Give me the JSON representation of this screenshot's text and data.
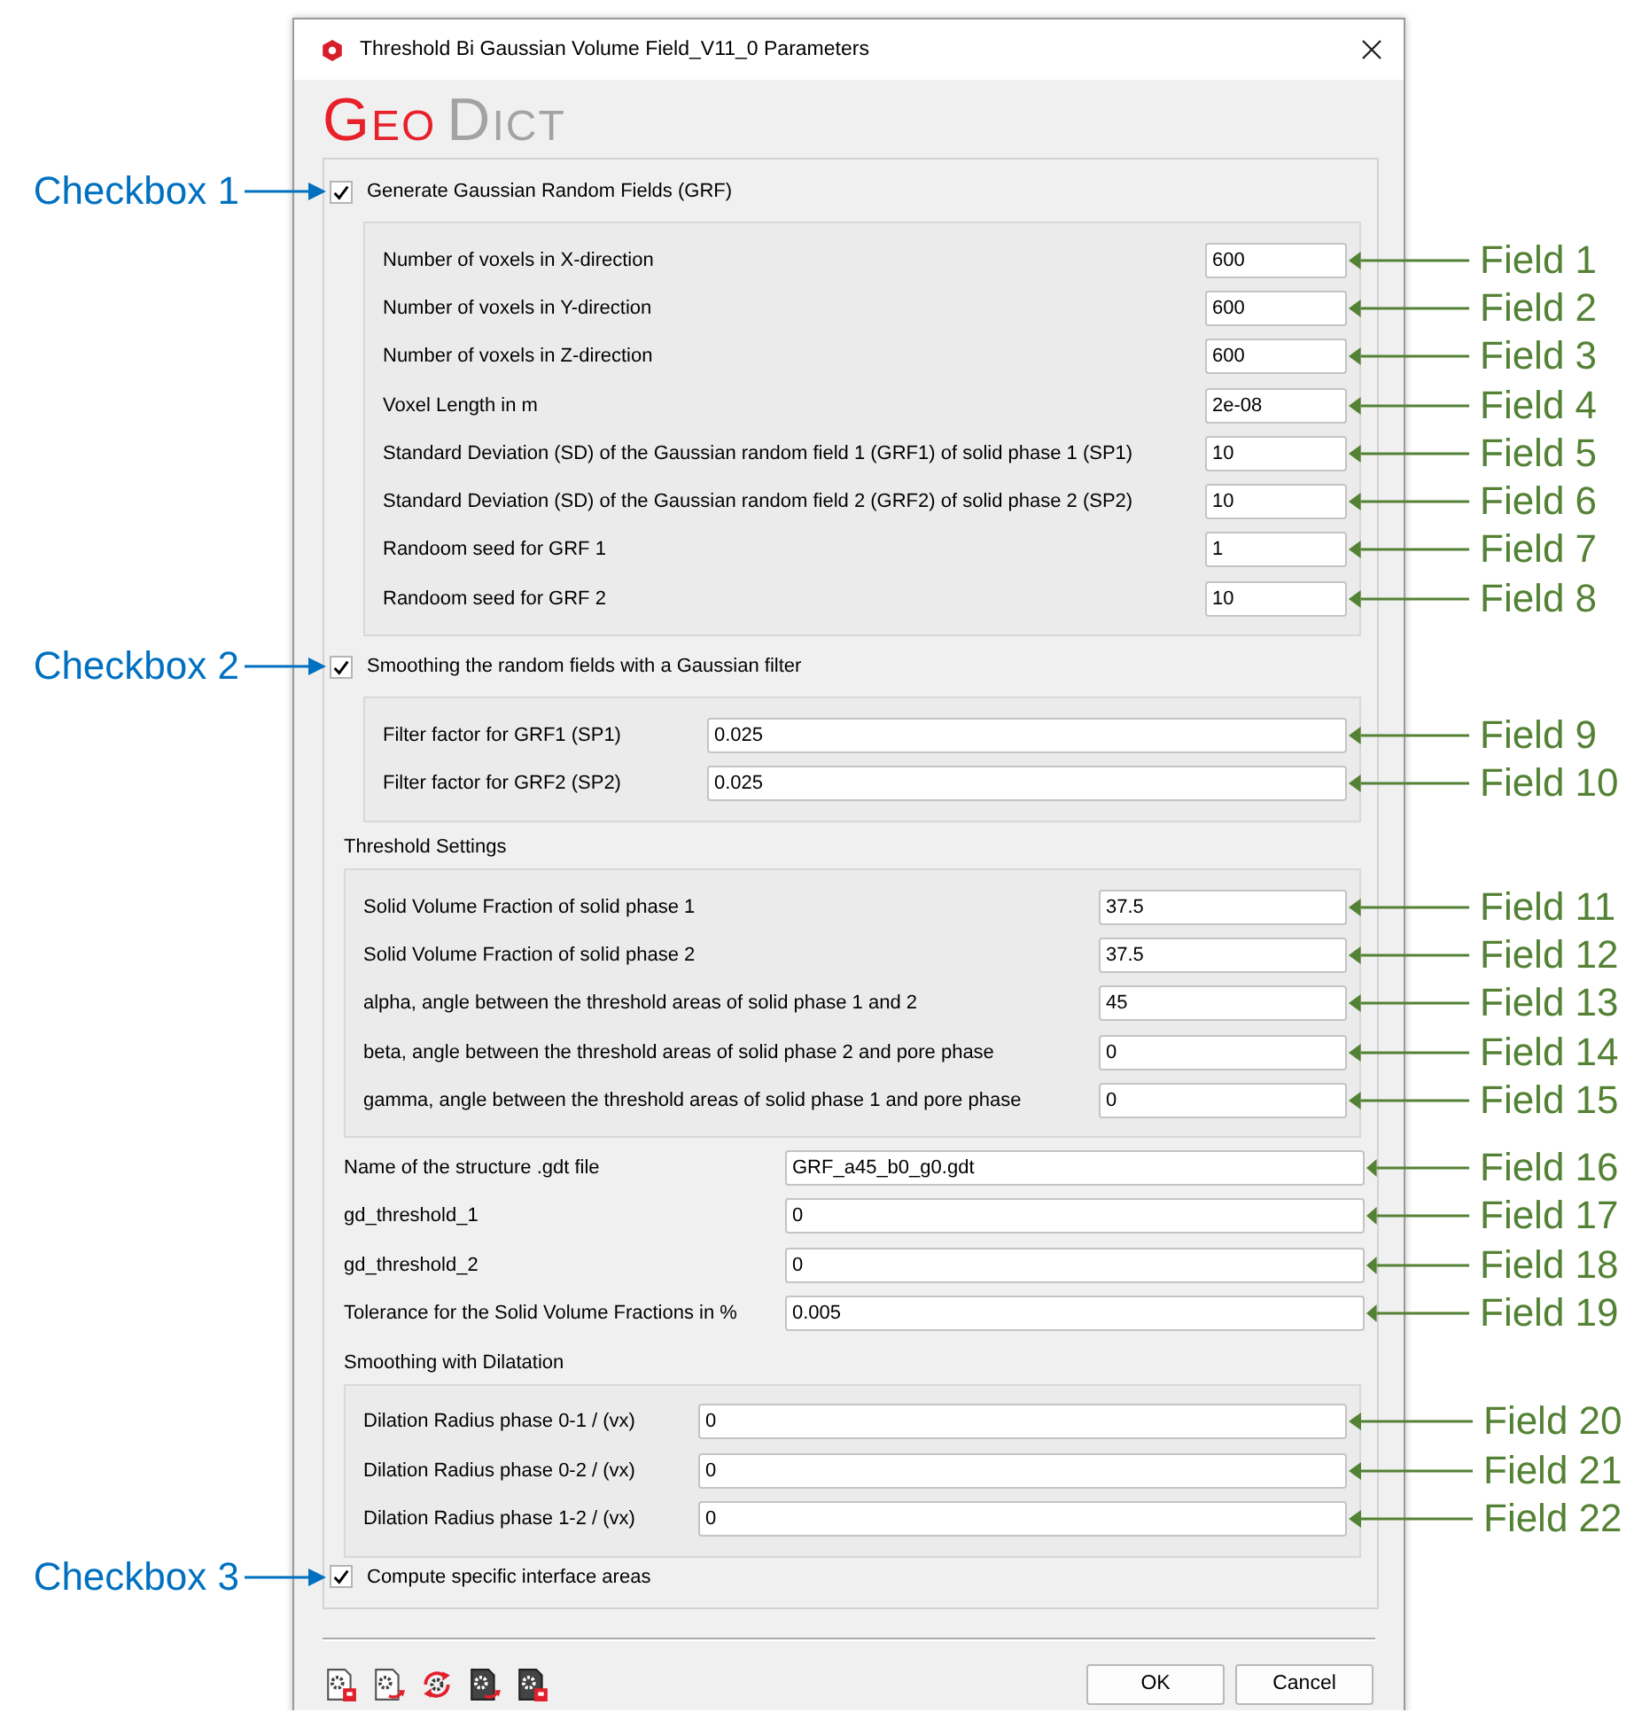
{
  "window": {
    "title": "Threshold Bi Gaussian Volume Field_V11_0 Parameters"
  },
  "logo": [
    {
      "text": "GEO",
      "color": "#e8202a"
    },
    {
      "text": "DICT",
      "color": "#a3a3a3"
    }
  ],
  "sections": [
    {
      "kind": "checkbox_group",
      "label": "Generate Gaussian Random Fields (GRF)",
      "checked": true,
      "callout": "Checkbox 1",
      "fields": [
        {
          "label": "Number of voxels in X-direction",
          "value": "600",
          "callout": "Field 1"
        },
        {
          "label": "Number of voxels in Y-direction",
          "value": "600",
          "callout": "Field 2"
        },
        {
          "label": "Number of voxels in Z-direction",
          "value": "600",
          "callout": "Field 3"
        },
        {
          "label": "Voxel Length in m",
          "value": "2e-08",
          "callout": "Field 4"
        },
        {
          "label": "Standard Deviation (SD) of the Gaussian random field 1 (GRF1) of solid phase 1 (SP1)",
          "value": "10",
          "callout": "Field 5"
        },
        {
          "label": "Standard Deviation (SD) of the Gaussian random field 2 (GRF2) of solid phase 2 (SP2)",
          "value": "10",
          "callout": "Field 6"
        },
        {
          "label": "Randoom seed for GRF 1",
          "value": "1",
          "callout": "Field 7"
        },
        {
          "label": "Randoom seed for GRF 2",
          "value": "10",
          "callout": "Field 8"
        }
      ]
    },
    {
      "kind": "checkbox_group",
      "label": "Smoothing the random fields with a Gaussian filter",
      "checked": true,
      "callout": "Checkbox 2",
      "fields": [
        {
          "label": "Filter factor for GRF1 (SP1)",
          "value": "0.025",
          "callout": "Field 9"
        },
        {
          "label": "Filter factor for GRF2 (SP2)",
          "value": "0.025",
          "callout": "Field 10"
        }
      ]
    },
    {
      "kind": "titled_group",
      "title": "Threshold Settings",
      "fields": [
        {
          "label": "Solid Volume Fraction of solid phase 1",
          "value": "37.5",
          "callout": "Field 11"
        },
        {
          "label": "Solid Volume Fraction of solid phase 2",
          "value": "37.5",
          "callout": "Field 12"
        },
        {
          "label": "alpha, angle between the threshold areas of solid phase 1 and 2",
          "value": "45",
          "callout": "Field 13"
        },
        {
          "label": "beta, angle between the threshold areas of solid phase 2 and pore phase",
          "value": "0",
          "callout": "Field 14"
        },
        {
          "label": "gamma, angle between the threshold areas of solid phase 1 and pore phase",
          "value": "0",
          "callout": "Field 15"
        }
      ]
    },
    {
      "kind": "field_list",
      "fields": [
        {
          "label": "Name of the structure .gdt file",
          "value": "GRF_a45_b0_g0.gdt",
          "callout": "Field 16"
        },
        {
          "label": "gd_threshold_1",
          "value": "0",
          "callout": "Field 17"
        },
        {
          "label": "gd_threshold_2",
          "value": "0",
          "callout": "Field 18"
        },
        {
          "label": "Tolerance for the Solid Volume Fractions in %",
          "value": "0.005",
          "callout": "Field 19"
        }
      ]
    },
    {
      "kind": "titled_group",
      "title": "Smoothing with Dilatation",
      "fields": [
        {
          "label": "Dilation Radius phase 0-1 / (vx)",
          "value": "0",
          "callout": "Field 20"
        },
        {
          "label": "Dilation Radius phase 0-2 / (vx)",
          "value": "0",
          "callout": "Field 21"
        },
        {
          "label": "Dilation Radius  phase 1-2 / (vx)",
          "value": "0",
          "callout": "Field 22"
        }
      ]
    },
    {
      "kind": "checkbox",
      "label": "Compute specific interface areas",
      "checked": true,
      "callout": "Checkbox 3"
    }
  ],
  "buttons": [
    "OK",
    "Cancel"
  ]
}
